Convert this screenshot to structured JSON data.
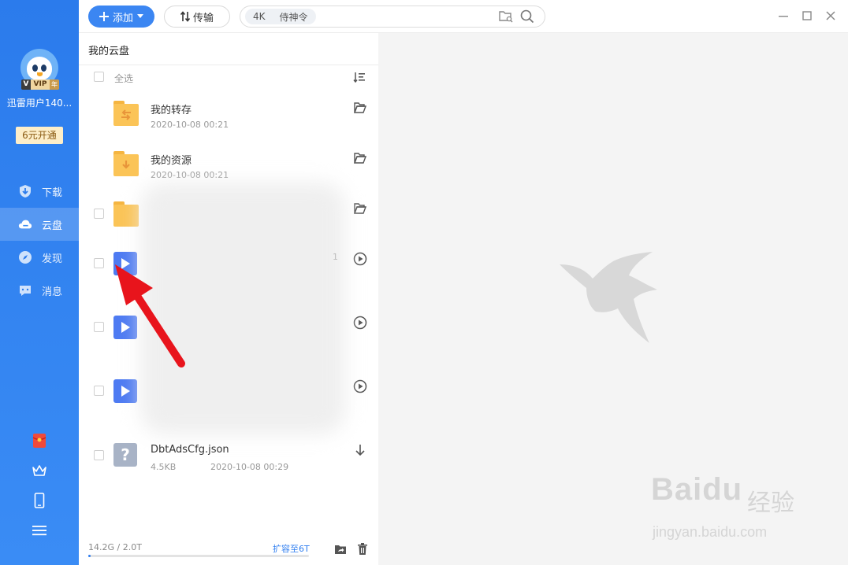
{
  "sidebar": {
    "vip_badge": {
      "v": "V",
      "vip": "VIP",
      "year": "年"
    },
    "username": "迅雷用户140...",
    "vip_offer": "6元开通",
    "nav": [
      {
        "label": "下载",
        "icon": "download-shield-icon"
      },
      {
        "label": "云盘",
        "icon": "cloud-icon",
        "active": true
      },
      {
        "label": "发现",
        "icon": "compass-icon"
      },
      {
        "label": "消息",
        "icon": "chat-icon"
      }
    ],
    "bottom_icons": [
      "red-envelope-icon",
      "crown-icon",
      "phone-icon",
      "menu-icon"
    ]
  },
  "toolbar": {
    "add_label": "添加",
    "transfer_label": "传输",
    "search_chip_1": "4K",
    "search_chip_2": "侍神令"
  },
  "panel": {
    "title": "我的云盘",
    "select_all": "全选",
    "files": [
      {
        "name": "我的转存",
        "date": "2020-10-08 00:21",
        "type": "folder-transfer",
        "action": "open-folder-icon",
        "checkbox": false
      },
      {
        "name": "我的资源",
        "date": "2020-10-08 00:21",
        "type": "folder-resource",
        "action": "open-folder-icon",
        "checkbox": false
      },
      {
        "name": "",
        "date": "",
        "type": "folder",
        "action": "open-folder-icon",
        "checkbox": true
      },
      {
        "name": "",
        "date": "",
        "type": "video",
        "action": "play-icon",
        "checkbox": true
      },
      {
        "name": "",
        "date": "",
        "type": "video",
        "action": "play-icon",
        "checkbox": true
      },
      {
        "name": "",
        "date": "",
        "type": "video",
        "action": "play-icon",
        "checkbox": true
      },
      {
        "name": "DbtAdsCfg.json",
        "size": "4.5KB",
        "date": "2020-10-08 00:29",
        "type": "unknown",
        "action": "download-icon",
        "checkbox": true
      }
    ],
    "faint_count": "1",
    "storage_text": "14.2G / 2.0T",
    "storage_used_fraction": 0.007,
    "expand_link": "扩容至6T"
  },
  "watermark": {
    "logo": "Baidu",
    "cn": "经验",
    "url": "jingyan.baidu.com"
  },
  "colors": {
    "accent": "#3b86f2",
    "sidebar": "#2b7bec",
    "folder": "#fbc457",
    "video": "#4e7bf2",
    "arrow": "#e8141c"
  }
}
